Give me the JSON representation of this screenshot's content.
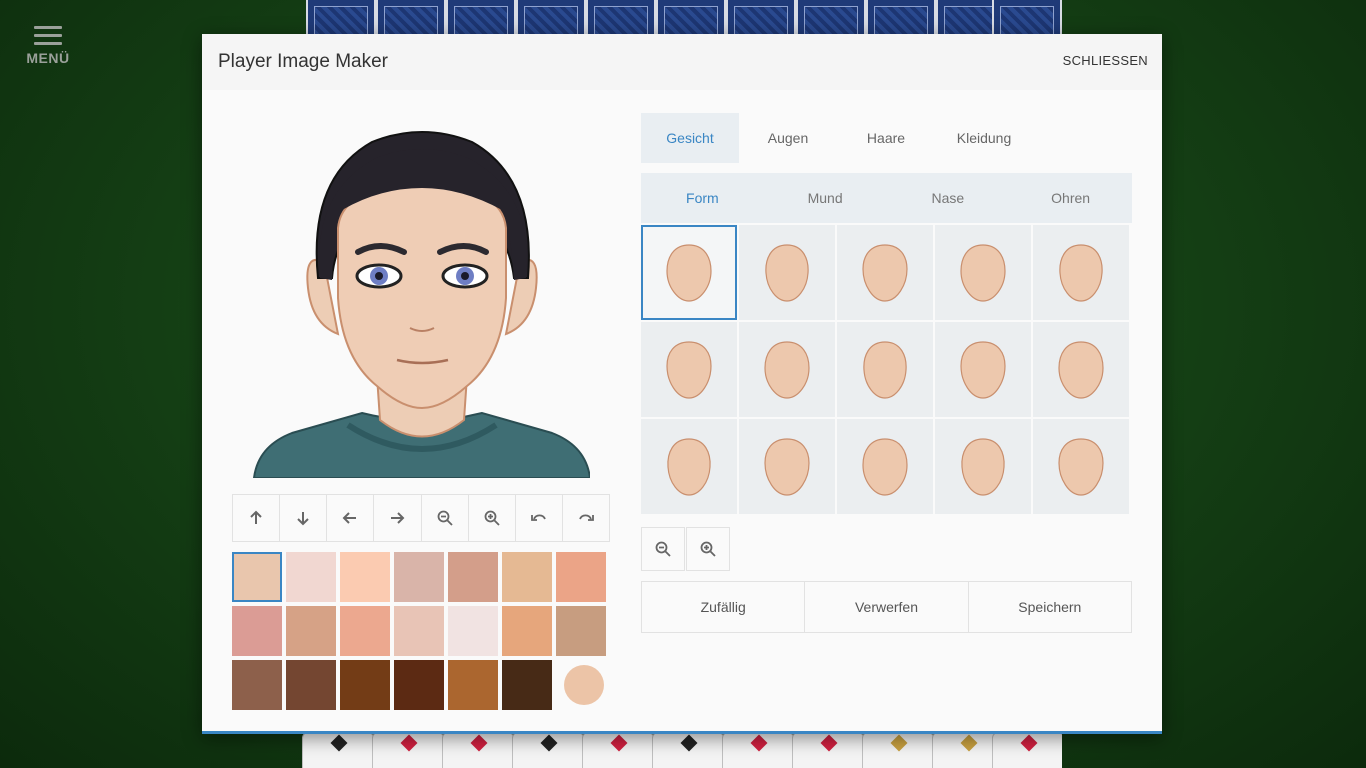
{
  "menu": {
    "label": "MENÜ",
    "icon": "hamburger-icon"
  },
  "dialog": {
    "title": "Player Image Maker",
    "close_label": "SCHLIESSEN"
  },
  "toolbar": {
    "buttons": [
      {
        "icon": "arrow-up-icon"
      },
      {
        "icon": "arrow-down-icon"
      },
      {
        "icon": "arrow-left-icon"
      },
      {
        "icon": "arrow-right-icon"
      },
      {
        "icon": "zoom-out-icon"
      },
      {
        "icon": "zoom-in-icon"
      },
      {
        "icon": "undo-icon"
      },
      {
        "icon": "redo-icon"
      }
    ]
  },
  "swatches": {
    "rows": [
      [
        "#e9c6ad",
        "#f1d7d1",
        "#fbcbb1",
        "#d9b4a9",
        "#d39e8a",
        "#e5b993",
        "#eba487"
      ],
      [
        "#db9c95",
        "#d6a286",
        "#eca88f",
        "#e8c4b6",
        "#f1e3e2",
        "#e6a67c",
        "#c79d80"
      ],
      [
        "#8d604b",
        "#744631",
        "#733c16",
        "#5c2a13",
        "#ab662f",
        "#472a16"
      ]
    ],
    "selected": 0,
    "picker_color": "#ecc4a7"
  },
  "tabs": {
    "items": [
      {
        "label": "Gesicht",
        "active": true
      },
      {
        "label": "Augen",
        "active": false
      },
      {
        "label": "Haare",
        "active": false
      },
      {
        "label": "Kleidung",
        "active": false
      }
    ]
  },
  "subtabs": {
    "items": [
      {
        "label": "Form",
        "active": true
      },
      {
        "label": "Mund",
        "active": false
      },
      {
        "label": "Nase",
        "active": false
      },
      {
        "label": "Ohren",
        "active": false
      }
    ]
  },
  "face_grid": {
    "count": 15,
    "selected": 0,
    "skin_color": "#edc8ad",
    "outline_color": "#c98f6e"
  },
  "zoom": {
    "buttons": [
      {
        "icon": "zoom-out-icon"
      },
      {
        "icon": "zoom-in-icon"
      }
    ]
  },
  "actions": {
    "random_label": "Zufällig",
    "discard_label": "Verwerfen",
    "save_label": "Speichern"
  },
  "colors": {
    "accent": "#3a86c4",
    "shirt": "#3f6e74",
    "hair": "#26232b",
    "skin": "#efcdb5"
  }
}
